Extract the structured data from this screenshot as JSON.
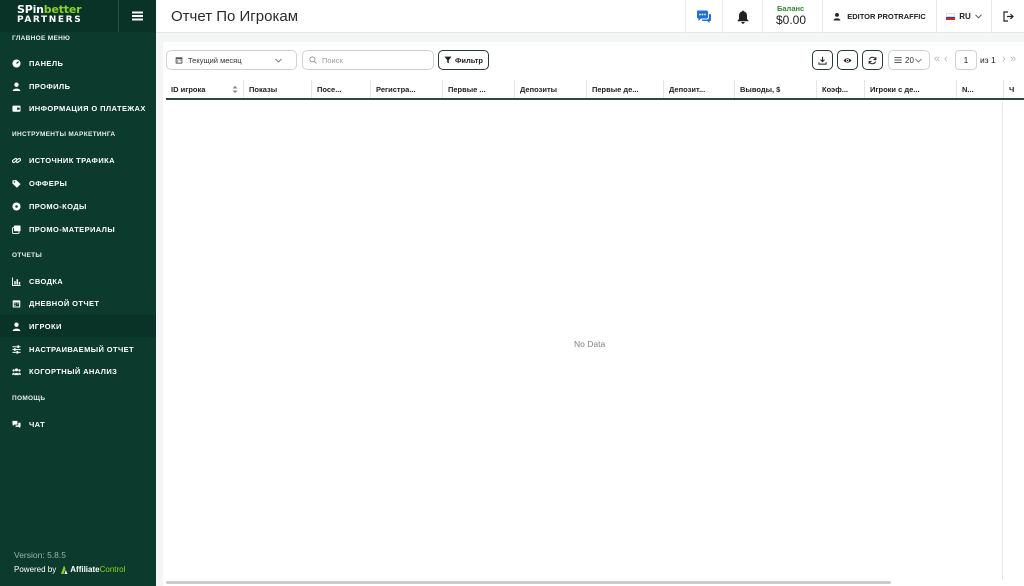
{
  "sidebar": {
    "logo": {
      "line1_a": "SPin",
      "line1_b": "better",
      "line2": "PARTNERS"
    },
    "sections": [
      {
        "title": "ГЛАВНОЕ МЕНЮ",
        "items": [
          {
            "label": "ПАНЕЛЬ",
            "icon": "dashboard-icon"
          },
          {
            "label": "ПРОФИЛЬ",
            "icon": "user-icon"
          },
          {
            "label": "ИНФОРМАЦИЯ О ПЛАТЕЖАХ",
            "icon": "wallet-icon"
          }
        ]
      },
      {
        "title": "ИНСТРУМЕНТЫ МАРКЕТИНГА",
        "items": [
          {
            "label": "ИСТОЧНИК ТРАФИКА",
            "icon": "link-icon"
          },
          {
            "label": "ОФФЕРЫ",
            "icon": "tag-icon"
          },
          {
            "label": "ПРОМО-КОДЫ",
            "icon": "promo-code-icon"
          },
          {
            "label": "ПРОМО-МАТЕРИАЛЫ",
            "icon": "images-icon"
          }
        ]
      },
      {
        "title": "ОТЧЕТЫ",
        "items": [
          {
            "label": "СВОДКА",
            "icon": "chart-icon"
          },
          {
            "label": "ДНЕВНОЙ ОТЧЕТ",
            "icon": "calendar-icon"
          },
          {
            "label": "ИГРОКИ",
            "icon": "user-icon",
            "active": true
          },
          {
            "label": "НАСТРАИВАЕМЫЙ ОТЧЕТ",
            "icon": "sliders-icon"
          },
          {
            "label": "КОГОРТНЫЙ АНАЛИЗ",
            "icon": "users-icon"
          }
        ]
      },
      {
        "title": "ПОМОЩЬ",
        "items": [
          {
            "label": "ЧАТ",
            "icon": "chat-icon"
          }
        ]
      }
    ],
    "version": "Version: 5.8.5",
    "powered_by": "Powered by",
    "powered_brand_a": "Affiliate",
    "powered_brand_b": "Control"
  },
  "header": {
    "title": "Отчет По Игрокам",
    "balance_label": "Баланс",
    "balance_value": "$0.00",
    "user": "EDITOR PROTRAFFIC",
    "language": "RU"
  },
  "toolbar": {
    "period": "Текущий месяц",
    "search_placeholder": "Поиск",
    "filter_label": "Фильтр",
    "page_size": "20",
    "page": "1",
    "of_total": "из 1"
  },
  "table": {
    "columns": [
      "ID игрока",
      "Показы",
      "Посе...",
      "Регистра...",
      "Первые ...",
      "Депозиты",
      "Первые де...",
      "Депозит...",
      "Выводы, $",
      "Коэф...",
      "Игроки с де...",
      "N...",
      "Ч"
    ],
    "empty_text": "No Data"
  },
  "colors": {
    "sidebar_bg": "#0c3b2e",
    "accent_green": "#8cd21f",
    "balance_green": "#2e8b2e",
    "table_header_rule": "#2d4a3f"
  }
}
